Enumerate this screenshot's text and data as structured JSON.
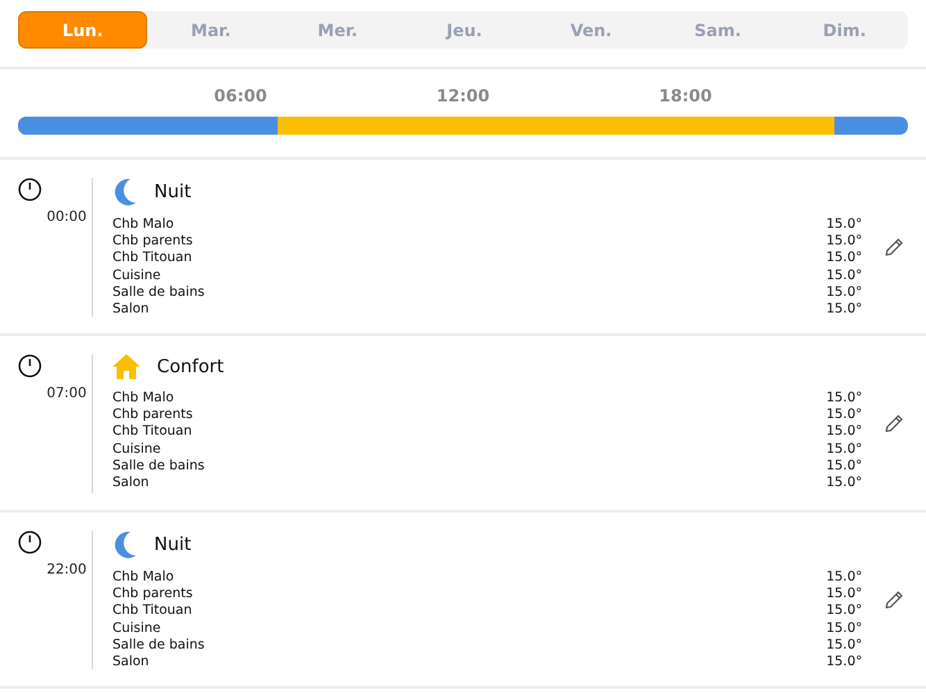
{
  "days": [
    {
      "label": "Lun.",
      "selected": true
    },
    {
      "label": "Mar.",
      "selected": false
    },
    {
      "label": "Mer.",
      "selected": false
    },
    {
      "label": "Jeu.",
      "selected": false
    },
    {
      "label": "Ven.",
      "selected": false
    },
    {
      "label": "Sam.",
      "selected": false
    },
    {
      "label": "Dim.",
      "selected": false
    }
  ],
  "timeline": {
    "ticks": [
      "06:00",
      "12:00",
      "18:00"
    ],
    "segments": [
      {
        "color": "#4a90e2",
        "level": 0.2917
      },
      {
        "color": "#fcbe03",
        "level": 0.9167
      },
      {
        "color": "#4a90e2"
      }
    ]
  },
  "periods": [
    {
      "time": "00:00",
      "kind": "night",
      "mode": "Nuit",
      "rooms": [
        {
          "name": "Chb Malo",
          "temp": "15.0°"
        },
        {
          "name": "Chb parents",
          "temp": "15.0°"
        },
        {
          "name": "Chb Titouan",
          "temp": "15.0°"
        },
        {
          "name": "Cuisine",
          "temp": "15.0°"
        },
        {
          "name": "Salle de bains",
          "temp": "15.0°"
        },
        {
          "name": "Salon",
          "temp": "15.0°"
        }
      ]
    },
    {
      "time": "07:00",
      "kind": "comfort",
      "mode": "Confort",
      "rooms": [
        {
          "name": "Chb Malo",
          "temp": "15.0°"
        },
        {
          "name": "Chb parents",
          "temp": "15.0°"
        },
        {
          "name": "Chb Titouan",
          "temp": "15.0°"
        },
        {
          "name": "Cuisine",
          "temp": "15.0°"
        },
        {
          "name": "Salle de bains",
          "temp": "15.0°"
        },
        {
          "name": "Salon",
          "temp": "15.0°"
        }
      ]
    },
    {
      "time": "22:00",
      "kind": "night",
      "mode": "Nuit",
      "rooms": [
        {
          "name": "Chb Malo",
          "temp": "15.0°"
        },
        {
          "name": "Chb parents",
          "temp": "15.0°"
        },
        {
          "name": "Chb Titouan",
          "temp": "15.0°"
        },
        {
          "name": "Cuisine",
          "temp": "15.0°"
        },
        {
          "name": "Salle de bains",
          "temp": "15.0°"
        },
        {
          "name": "Salon",
          "temp": "15.0°"
        }
      ]
    }
  ]
}
